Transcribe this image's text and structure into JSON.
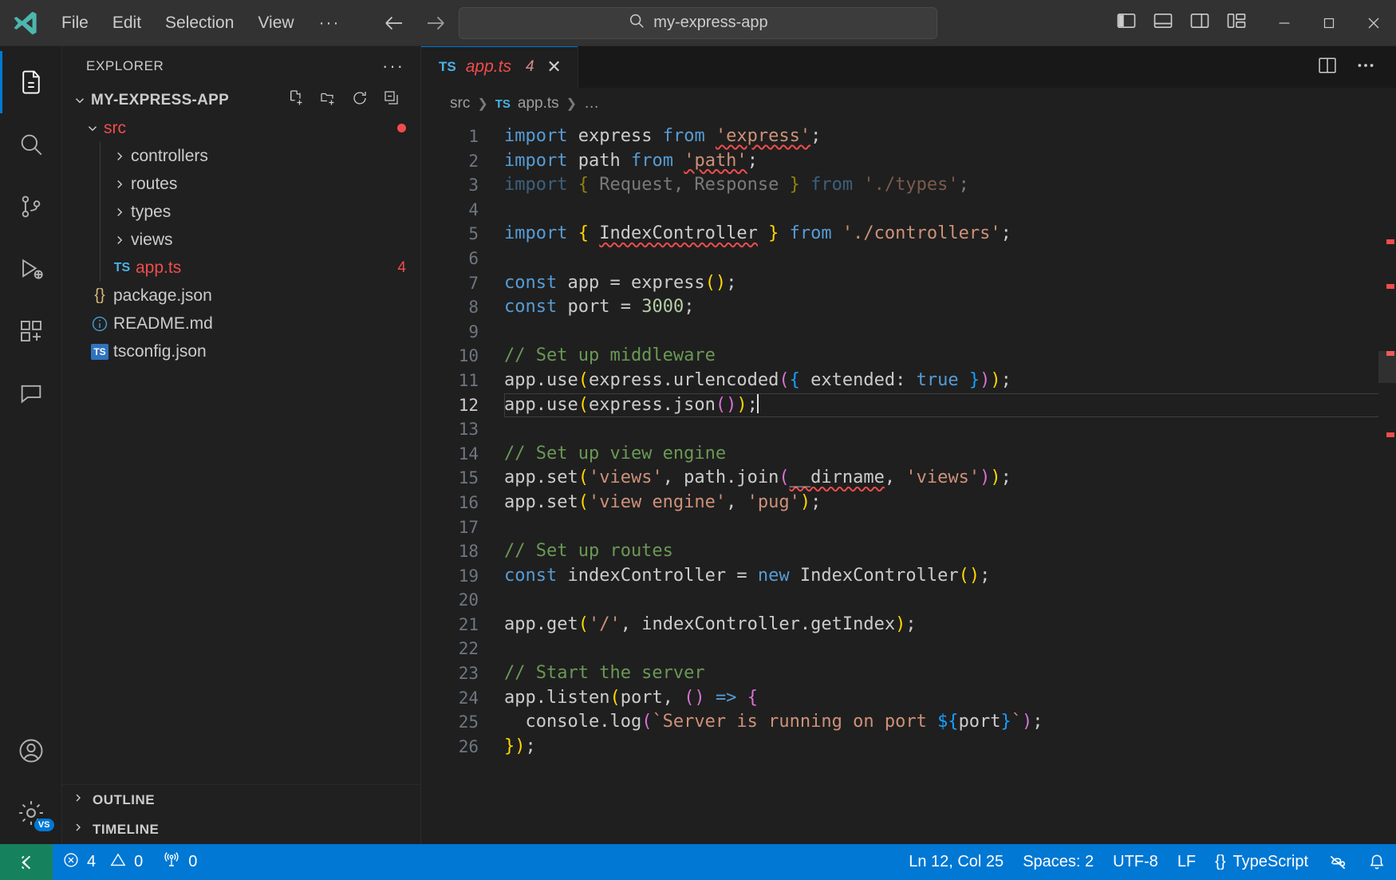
{
  "titlebar": {
    "logo": "vscode-logo-icon",
    "menus": [
      "File",
      "Edit",
      "Selection",
      "View"
    ],
    "overflow_label": "···",
    "nav": {
      "back": "back-arrow-icon",
      "forward": "forward-arrow-icon"
    },
    "search": {
      "value": "my-express-app",
      "icon": "search-icon"
    },
    "layout_icons": [
      "toggle-primary-sidebar-icon",
      "toggle-panel-icon",
      "toggle-secondary-sidebar-icon",
      "customize-layout-icon"
    ],
    "window_controls": {
      "minimize": "—",
      "maximize": "□",
      "close": "✕"
    }
  },
  "activitybar": {
    "items": [
      {
        "name": "explorer",
        "icon": "files-icon",
        "active": true,
        "badge": ""
      },
      {
        "name": "search",
        "icon": "search-icon",
        "active": false,
        "badge": ""
      },
      {
        "name": "source-control",
        "icon": "source-control-icon",
        "active": false,
        "badge": ""
      },
      {
        "name": "run-and-debug",
        "icon": "debug-icon",
        "active": false,
        "badge": ""
      },
      {
        "name": "extensions",
        "icon": "extensions-icon",
        "active": false,
        "badge": ""
      },
      {
        "name": "chat",
        "icon": "comment-icon",
        "active": false,
        "badge": ""
      }
    ],
    "bottom": [
      {
        "name": "accounts",
        "icon": "account-icon"
      },
      {
        "name": "manage",
        "icon": "gear-icon",
        "badge": "VS"
      }
    ]
  },
  "sidebar": {
    "title": "EXPLORER",
    "more_actions": "···",
    "root": {
      "label": "MY-EXPRESS-APP",
      "expanded": true,
      "actions": [
        "new-file-icon",
        "new-folder-icon",
        "refresh-icon",
        "collapse-all-icon"
      ]
    },
    "tree": [
      {
        "label": "src",
        "type": "folder",
        "expanded": true,
        "indent": 1,
        "error": true,
        "marker": "dot"
      },
      {
        "label": "controllers",
        "type": "folder",
        "expanded": false,
        "indent": 2,
        "error": false
      },
      {
        "label": "routes",
        "type": "folder",
        "expanded": false,
        "indent": 2,
        "error": false
      },
      {
        "label": "types",
        "type": "folder",
        "expanded": false,
        "indent": 2,
        "error": false
      },
      {
        "label": "views",
        "type": "folder",
        "expanded": false,
        "indent": 2,
        "error": false
      },
      {
        "label": "app.ts",
        "type": "ts",
        "indent": 2,
        "error": true,
        "count": "4"
      },
      {
        "label": "package.json",
        "type": "json",
        "indent": 1,
        "error": false
      },
      {
        "label": "README.md",
        "type": "md",
        "indent": 1,
        "error": false
      },
      {
        "label": "tsconfig.json",
        "type": "tsconfig",
        "indent": 1,
        "error": false
      }
    ],
    "panels": [
      {
        "label": "OUTLINE",
        "expanded": false
      },
      {
        "label": "TIMELINE",
        "expanded": false
      }
    ]
  },
  "editor": {
    "tab": {
      "icon_label": "TS",
      "label": "app.ts",
      "badge": "4",
      "close": "✕",
      "preview_italic": true
    },
    "tabbar_actions": [
      "split-editor-icon",
      "more-actions-icon"
    ],
    "breadcrumb": {
      "parts": [
        "src",
        "app.ts",
        "…"
      ],
      "file_icon": "TS"
    },
    "cursor_line": 12,
    "lines": [
      {
        "n": 1,
        "tokens": [
          {
            "t": "import",
            "c": "kw"
          },
          {
            "t": " express ",
            "c": "pl"
          },
          {
            "t": "from",
            "c": "kw"
          },
          {
            "t": " ",
            "c": "pl"
          },
          {
            "t": "'express'",
            "c": "str squig"
          },
          {
            "t": ";",
            "c": "pl"
          }
        ]
      },
      {
        "n": 2,
        "tokens": [
          {
            "t": "import",
            "c": "kw"
          },
          {
            "t": " path ",
            "c": "pl"
          },
          {
            "t": "from",
            "c": "kw"
          },
          {
            "t": " ",
            "c": "pl"
          },
          {
            "t": "'path'",
            "c": "str squig"
          },
          {
            "t": ";",
            "c": "pl"
          }
        ]
      },
      {
        "n": 3,
        "tokens": [
          {
            "t": "import",
            "c": "kw dim"
          },
          {
            "t": " ",
            "c": "pl"
          },
          {
            "t": "{",
            "c": "br1 dim"
          },
          {
            "t": " Request, Response ",
            "c": "pl dim"
          },
          {
            "t": "}",
            "c": "br1 dim"
          },
          {
            "t": " ",
            "c": "pl"
          },
          {
            "t": "from",
            "c": "kw dim"
          },
          {
            "t": " ",
            "c": "pl"
          },
          {
            "t": "'./types'",
            "c": "str dim"
          },
          {
            "t": ";",
            "c": "pl dim"
          }
        ]
      },
      {
        "n": 4,
        "tokens": []
      },
      {
        "n": 5,
        "tokens": [
          {
            "t": "import",
            "c": "kw"
          },
          {
            "t": " ",
            "c": "pl"
          },
          {
            "t": "{",
            "c": "br1"
          },
          {
            "t": " ",
            "c": "pl"
          },
          {
            "t": "IndexController",
            "c": "pl squig"
          },
          {
            "t": " ",
            "c": "pl"
          },
          {
            "t": "}",
            "c": "br1"
          },
          {
            "t": " ",
            "c": "pl"
          },
          {
            "t": "from",
            "c": "kw"
          },
          {
            "t": " ",
            "c": "pl"
          },
          {
            "t": "'./controllers'",
            "c": "str"
          },
          {
            "t": ";",
            "c": "pl"
          }
        ]
      },
      {
        "n": 6,
        "tokens": []
      },
      {
        "n": 7,
        "tokens": [
          {
            "t": "const",
            "c": "kw"
          },
          {
            "t": " app ",
            "c": "pl"
          },
          {
            "t": "=",
            "c": "pl"
          },
          {
            "t": " express",
            "c": "pl"
          },
          {
            "t": "()",
            "c": "br1"
          },
          {
            "t": ";",
            "c": "pl"
          }
        ]
      },
      {
        "n": 8,
        "tokens": [
          {
            "t": "const",
            "c": "kw"
          },
          {
            "t": " port ",
            "c": "pl"
          },
          {
            "t": "=",
            "c": "pl"
          },
          {
            "t": " ",
            "c": "pl"
          },
          {
            "t": "3000",
            "c": "num"
          },
          {
            "t": ";",
            "c": "pl"
          }
        ]
      },
      {
        "n": 9,
        "tokens": []
      },
      {
        "n": 10,
        "tokens": [
          {
            "t": "// Set up middleware",
            "c": "com"
          }
        ]
      },
      {
        "n": 11,
        "tokens": [
          {
            "t": "app.use",
            "c": "pl"
          },
          {
            "t": "(",
            "c": "br1"
          },
          {
            "t": "express.urlencoded",
            "c": "pl"
          },
          {
            "t": "(",
            "c": "br2"
          },
          {
            "t": "{",
            "c": "br3"
          },
          {
            "t": " extended: ",
            "c": "pl"
          },
          {
            "t": "true",
            "c": "kw"
          },
          {
            "t": " ",
            "c": "pl"
          },
          {
            "t": "}",
            "c": "br3"
          },
          {
            "t": ")",
            "c": "br2"
          },
          {
            "t": ")",
            "c": "br1"
          },
          {
            "t": ";",
            "c": "pl"
          }
        ]
      },
      {
        "n": 12,
        "tokens": [
          {
            "t": "app.use",
            "c": "pl"
          },
          {
            "t": "(",
            "c": "br1"
          },
          {
            "t": "express.json",
            "c": "pl"
          },
          {
            "t": "(",
            "c": "br2"
          },
          {
            "t": ")",
            "c": "br2"
          },
          {
            "t": ")",
            "c": "br1"
          },
          {
            "t": ";",
            "c": "pl"
          }
        ],
        "current": true
      },
      {
        "n": 13,
        "tokens": []
      },
      {
        "n": 14,
        "tokens": [
          {
            "t": "// Set up view engine",
            "c": "com"
          }
        ]
      },
      {
        "n": 15,
        "tokens": [
          {
            "t": "app.set",
            "c": "pl"
          },
          {
            "t": "(",
            "c": "br1"
          },
          {
            "t": "'views'",
            "c": "str"
          },
          {
            "t": ", path.join",
            "c": "pl"
          },
          {
            "t": "(",
            "c": "br2"
          },
          {
            "t": "__dirname",
            "c": "pl squig"
          },
          {
            "t": ", ",
            "c": "pl"
          },
          {
            "t": "'views'",
            "c": "str"
          },
          {
            "t": ")",
            "c": "br2"
          },
          {
            "t": ")",
            "c": "br1"
          },
          {
            "t": ";",
            "c": "pl"
          }
        ]
      },
      {
        "n": 16,
        "tokens": [
          {
            "t": "app.set",
            "c": "pl"
          },
          {
            "t": "(",
            "c": "br1"
          },
          {
            "t": "'view engine'",
            "c": "str"
          },
          {
            "t": ", ",
            "c": "pl"
          },
          {
            "t": "'pug'",
            "c": "str"
          },
          {
            "t": ")",
            "c": "br1"
          },
          {
            "t": ";",
            "c": "pl"
          }
        ]
      },
      {
        "n": 17,
        "tokens": []
      },
      {
        "n": 18,
        "tokens": [
          {
            "t": "// Set up routes",
            "c": "com"
          }
        ]
      },
      {
        "n": 19,
        "tokens": [
          {
            "t": "const",
            "c": "kw"
          },
          {
            "t": " indexController ",
            "c": "pl"
          },
          {
            "t": "=",
            "c": "pl"
          },
          {
            "t": " ",
            "c": "pl"
          },
          {
            "t": "new",
            "c": "kw"
          },
          {
            "t": " IndexController",
            "c": "pl"
          },
          {
            "t": "()",
            "c": "br1"
          },
          {
            "t": ";",
            "c": "pl"
          }
        ]
      },
      {
        "n": 20,
        "tokens": []
      },
      {
        "n": 21,
        "tokens": [
          {
            "t": "app.get",
            "c": "pl"
          },
          {
            "t": "(",
            "c": "br1"
          },
          {
            "t": "'/'",
            "c": "str"
          },
          {
            "t": ", indexController.getIndex",
            "c": "pl"
          },
          {
            "t": ")",
            "c": "br1"
          },
          {
            "t": ";",
            "c": "pl"
          }
        ]
      },
      {
        "n": 22,
        "tokens": []
      },
      {
        "n": 23,
        "tokens": [
          {
            "t": "// Start the server",
            "c": "com"
          }
        ]
      },
      {
        "n": 24,
        "tokens": [
          {
            "t": "app.listen",
            "c": "pl"
          },
          {
            "t": "(",
            "c": "br1"
          },
          {
            "t": "port, ",
            "c": "pl"
          },
          {
            "t": "()",
            "c": "br2"
          },
          {
            "t": " ",
            "c": "pl"
          },
          {
            "t": "=>",
            "c": "kw"
          },
          {
            "t": " ",
            "c": "pl"
          },
          {
            "t": "{",
            "c": "br2"
          }
        ]
      },
      {
        "n": 25,
        "tokens": [
          {
            "t": "  console.log",
            "c": "pl"
          },
          {
            "t": "(",
            "c": "br2"
          },
          {
            "t": "`Server is running on port ",
            "c": "str"
          },
          {
            "t": "${",
            "c": "br3"
          },
          {
            "t": "port",
            "c": "pl"
          },
          {
            "t": "}",
            "c": "br3"
          },
          {
            "t": "`",
            "c": "str"
          },
          {
            "t": ")",
            "c": "br2"
          },
          {
            "t": ";",
            "c": "pl"
          }
        ]
      },
      {
        "n": 26,
        "tokens": [
          {
            "t": "}",
            "c": "br1"
          },
          {
            "t": ")",
            "c": "br1"
          },
          {
            "t": ";",
            "c": "pl"
          }
        ]
      }
    ]
  },
  "statusbar": {
    "remote_icon": "remote-window-icon",
    "errors": "4",
    "warnings": "0",
    "ports": "0",
    "position": "Ln 12, Col 25",
    "indentation": "Spaces: 2",
    "encoding": "UTF-8",
    "eol": "LF",
    "language": "TypeScript",
    "language_icon": "{}",
    "prettier_icon": "prettier-disabled-icon",
    "bell_icon": "bell-icon"
  },
  "colors": {
    "accent": "#0078d4",
    "remote": "#16825d",
    "error": "#f14c4c",
    "warning": "#cca700",
    "comment": "#6a9955",
    "string": "#ce9178",
    "keyword": "#569cd6"
  }
}
